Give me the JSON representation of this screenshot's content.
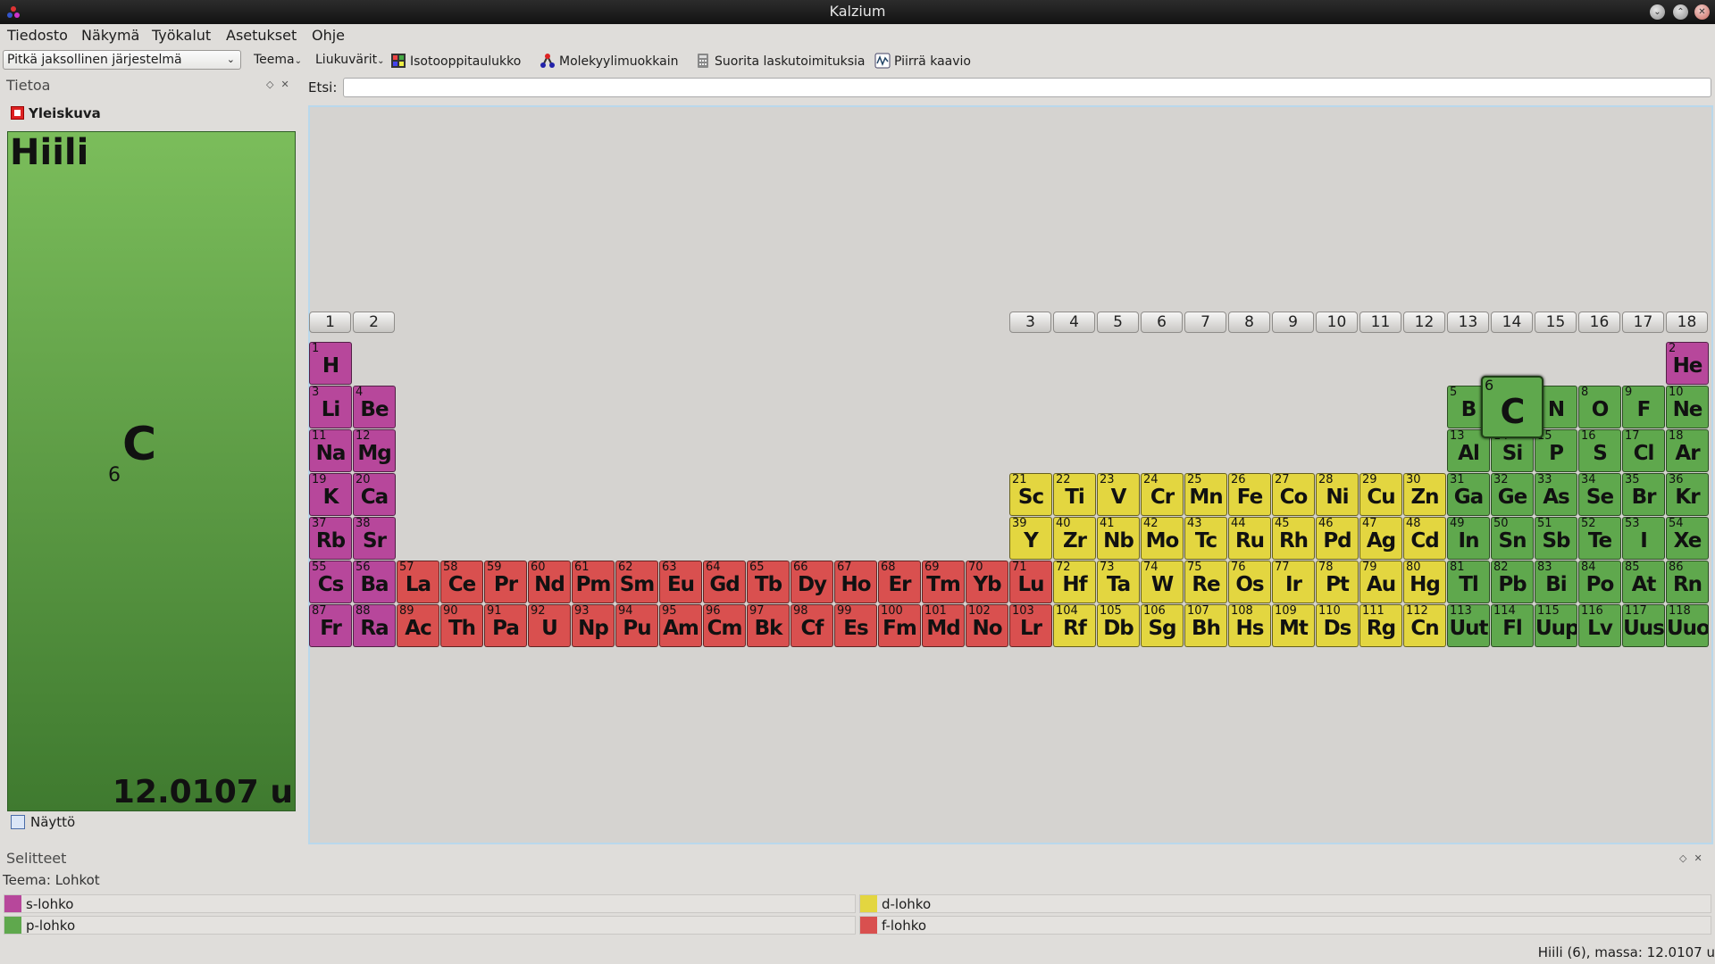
{
  "window": {
    "title": "Kalzium"
  },
  "menu": [
    "Tiedosto",
    "Näkymä",
    "Työkalut",
    "Asetukset",
    "Ohje"
  ],
  "toolbar": {
    "view_select": "Pitkä jaksollinen järjestelmä",
    "theme": "Teema",
    "sliders": "Liukuvärit",
    "isotope_table": "Isotooppitaulukko",
    "molecule_editor": "Molekyylimuokkain",
    "calculate": "Suorita laskutoimituksia",
    "plot": "Piirrä kaavio"
  },
  "info_dock": {
    "title": "Tietoa",
    "overview": "Yleiskuva",
    "element_name": "Hiili",
    "element_symbol": "C",
    "element_number": "6",
    "element_mass": "12.0107 u",
    "display_tab": "Näyttö"
  },
  "search": {
    "label": "Etsi:",
    "value": ""
  },
  "groups": [
    "1",
    "2",
    "3",
    "4",
    "5",
    "6",
    "7",
    "8",
    "9",
    "10",
    "11",
    "12",
    "13",
    "14",
    "15",
    "16",
    "17",
    "18"
  ],
  "block_colors": {
    "s": "#b7479b",
    "p": "#5fa84d",
    "d": "#e3d640",
    "f": "#d9504f"
  },
  "selected_element": "C",
  "elements": [
    {
      "n": 1,
      "s": "H",
      "r": 1,
      "c": 1,
      "b": "s"
    },
    {
      "n": 2,
      "s": "He",
      "r": 1,
      "c": 18,
      "b": "s"
    },
    {
      "n": 3,
      "s": "Li",
      "r": 2,
      "c": 1,
      "b": "s"
    },
    {
      "n": 4,
      "s": "Be",
      "r": 2,
      "c": 2,
      "b": "s"
    },
    {
      "n": 5,
      "s": "B",
      "r": 2,
      "c": 13,
      "b": "p"
    },
    {
      "n": 6,
      "s": "C",
      "r": 2,
      "c": 14,
      "b": "p"
    },
    {
      "n": 7,
      "s": "N",
      "r": 2,
      "c": 15,
      "b": "p"
    },
    {
      "n": 8,
      "s": "O",
      "r": 2,
      "c": 16,
      "b": "p"
    },
    {
      "n": 9,
      "s": "F",
      "r": 2,
      "c": 17,
      "b": "p"
    },
    {
      "n": 10,
      "s": "Ne",
      "r": 2,
      "c": 18,
      "b": "p"
    },
    {
      "n": 11,
      "s": "Na",
      "r": 3,
      "c": 1,
      "b": "s"
    },
    {
      "n": 12,
      "s": "Mg",
      "r": 3,
      "c": 2,
      "b": "s"
    },
    {
      "n": 13,
      "s": "Al",
      "r": 3,
      "c": 13,
      "b": "p"
    },
    {
      "n": 14,
      "s": "Si",
      "r": 3,
      "c": 14,
      "b": "p"
    },
    {
      "n": 15,
      "s": "P",
      "r": 3,
      "c": 15,
      "b": "p"
    },
    {
      "n": 16,
      "s": "S",
      "r": 3,
      "c": 16,
      "b": "p"
    },
    {
      "n": 17,
      "s": "Cl",
      "r": 3,
      "c": 17,
      "b": "p"
    },
    {
      "n": 18,
      "s": "Ar",
      "r": 3,
      "c": 18,
      "b": "p"
    },
    {
      "n": 19,
      "s": "K",
      "r": 4,
      "c": 1,
      "b": "s"
    },
    {
      "n": 20,
      "s": "Ca",
      "r": 4,
      "c": 2,
      "b": "s"
    },
    {
      "n": 21,
      "s": "Sc",
      "r": 4,
      "c": 3,
      "b": "d"
    },
    {
      "n": 22,
      "s": "Ti",
      "r": 4,
      "c": 4,
      "b": "d"
    },
    {
      "n": 23,
      "s": "V",
      "r": 4,
      "c": 5,
      "b": "d"
    },
    {
      "n": 24,
      "s": "Cr",
      "r": 4,
      "c": 6,
      "b": "d"
    },
    {
      "n": 25,
      "s": "Mn",
      "r": 4,
      "c": 7,
      "b": "d"
    },
    {
      "n": 26,
      "s": "Fe",
      "r": 4,
      "c": 8,
      "b": "d"
    },
    {
      "n": 27,
      "s": "Co",
      "r": 4,
      "c": 9,
      "b": "d"
    },
    {
      "n": 28,
      "s": "Ni",
      "r": 4,
      "c": 10,
      "b": "d"
    },
    {
      "n": 29,
      "s": "Cu",
      "r": 4,
      "c": 11,
      "b": "d"
    },
    {
      "n": 30,
      "s": "Zn",
      "r": 4,
      "c": 12,
      "b": "d"
    },
    {
      "n": 31,
      "s": "Ga",
      "r": 4,
      "c": 13,
      "b": "p"
    },
    {
      "n": 32,
      "s": "Ge",
      "r": 4,
      "c": 14,
      "b": "p"
    },
    {
      "n": 33,
      "s": "As",
      "r": 4,
      "c": 15,
      "b": "p"
    },
    {
      "n": 34,
      "s": "Se",
      "r": 4,
      "c": 16,
      "b": "p"
    },
    {
      "n": 35,
      "s": "Br",
      "r": 4,
      "c": 17,
      "b": "p"
    },
    {
      "n": 36,
      "s": "Kr",
      "r": 4,
      "c": 18,
      "b": "p"
    },
    {
      "n": 37,
      "s": "Rb",
      "r": 5,
      "c": 1,
      "b": "s"
    },
    {
      "n": 38,
      "s": "Sr",
      "r": 5,
      "c": 2,
      "b": "s"
    },
    {
      "n": 39,
      "s": "Y",
      "r": 5,
      "c": 3,
      "b": "d"
    },
    {
      "n": 40,
      "s": "Zr",
      "r": 5,
      "c": 4,
      "b": "d"
    },
    {
      "n": 41,
      "s": "Nb",
      "r": 5,
      "c": 5,
      "b": "d"
    },
    {
      "n": 42,
      "s": "Mo",
      "r": 5,
      "c": 6,
      "b": "d"
    },
    {
      "n": 43,
      "s": "Tc",
      "r": 5,
      "c": 7,
      "b": "d"
    },
    {
      "n": 44,
      "s": "Ru",
      "r": 5,
      "c": 8,
      "b": "d"
    },
    {
      "n": 45,
      "s": "Rh",
      "r": 5,
      "c": 9,
      "b": "d"
    },
    {
      "n": 46,
      "s": "Pd",
      "r": 5,
      "c": 10,
      "b": "d"
    },
    {
      "n": 47,
      "s": "Ag",
      "r": 5,
      "c": 11,
      "b": "d"
    },
    {
      "n": 48,
      "s": "Cd",
      "r": 5,
      "c": 12,
      "b": "d"
    },
    {
      "n": 49,
      "s": "In",
      "r": 5,
      "c": 13,
      "b": "p"
    },
    {
      "n": 50,
      "s": "Sn",
      "r": 5,
      "c": 14,
      "b": "p"
    },
    {
      "n": 51,
      "s": "Sb",
      "r": 5,
      "c": 15,
      "b": "p"
    },
    {
      "n": 52,
      "s": "Te",
      "r": 5,
      "c": 16,
      "b": "p"
    },
    {
      "n": 53,
      "s": "I",
      "r": 5,
      "c": 17,
      "b": "p"
    },
    {
      "n": 54,
      "s": "Xe",
      "r": 5,
      "c": 18,
      "b": "p"
    },
    {
      "n": 55,
      "s": "Cs",
      "r": 6,
      "c": 1,
      "b": "s"
    },
    {
      "n": 56,
      "s": "Ba",
      "r": 6,
      "c": 2,
      "b": "s"
    },
    {
      "n": 57,
      "s": "La",
      "r": 6,
      "c": 3,
      "b": "f"
    },
    {
      "n": 58,
      "s": "Ce",
      "r": 6,
      "c": 4,
      "b": "f"
    },
    {
      "n": 59,
      "s": "Pr",
      "r": 6,
      "c": 5,
      "b": "f"
    },
    {
      "n": 60,
      "s": "Nd",
      "r": 6,
      "c": 6,
      "b": "f"
    },
    {
      "n": 61,
      "s": "Pm",
      "r": 6,
      "c": 7,
      "b": "f"
    },
    {
      "n": 62,
      "s": "Sm",
      "r": 6,
      "c": 8,
      "b": "f"
    },
    {
      "n": 63,
      "s": "Eu",
      "r": 6,
      "c": 9,
      "b": "f"
    },
    {
      "n": 64,
      "s": "Gd",
      "r": 6,
      "c": 10,
      "b": "f"
    },
    {
      "n": 65,
      "s": "Tb",
      "r": 6,
      "c": 11,
      "b": "f"
    },
    {
      "n": 66,
      "s": "Dy",
      "r": 6,
      "c": 12,
      "b": "f"
    },
    {
      "n": 67,
      "s": "Ho",
      "r": 6,
      "c": 13,
      "b": "f"
    },
    {
      "n": 68,
      "s": "Er",
      "r": 6,
      "c": 14,
      "b": "f"
    },
    {
      "n": 69,
      "s": "Tm",
      "r": 6,
      "c": 15,
      "b": "f"
    },
    {
      "n": 70,
      "s": "Yb",
      "r": 6,
      "c": 16,
      "b": "f"
    },
    {
      "n": 71,
      "s": "Lu",
      "r": 6,
      "c": 17,
      "b": "f"
    },
    {
      "n": 72,
      "s": "Hf",
      "r": 6,
      "c": 18,
      "b": "d"
    },
    {
      "n": 73,
      "s": "Ta",
      "r": 6,
      "c": 19,
      "b": "d"
    },
    {
      "n": 74,
      "s": "W",
      "r": 6,
      "c": 20,
      "b": "d"
    },
    {
      "n": 75,
      "s": "Re",
      "r": 6,
      "c": 21,
      "b": "d"
    },
    {
      "n": 76,
      "s": "Os",
      "r": 6,
      "c": 22,
      "b": "d"
    },
    {
      "n": 77,
      "s": "Ir",
      "r": 6,
      "c": 23,
      "b": "d"
    },
    {
      "n": 78,
      "s": "Pt",
      "r": 6,
      "c": 24,
      "b": "d"
    },
    {
      "n": 79,
      "s": "Au",
      "r": 6,
      "c": 25,
      "b": "d"
    },
    {
      "n": 80,
      "s": "Hg",
      "r": 6,
      "c": 26,
      "b": "d"
    },
    {
      "n": 81,
      "s": "Tl",
      "r": 6,
      "c": 27,
      "b": "p"
    },
    {
      "n": 82,
      "s": "Pb",
      "r": 6,
      "c": 28,
      "b": "p"
    },
    {
      "n": 83,
      "s": "Bi",
      "r": 6,
      "c": 29,
      "b": "p"
    },
    {
      "n": 84,
      "s": "Po",
      "r": 6,
      "c": 30,
      "b": "p"
    },
    {
      "n": 85,
      "s": "At",
      "r": 6,
      "c": 31,
      "b": "p"
    },
    {
      "n": 86,
      "s": "Rn",
      "r": 6,
      "c": 32,
      "b": "p"
    },
    {
      "n": 87,
      "s": "Fr",
      "r": 7,
      "c": 1,
      "b": "s"
    },
    {
      "n": 88,
      "s": "Ra",
      "r": 7,
      "c": 2,
      "b": "s"
    },
    {
      "n": 89,
      "s": "Ac",
      "r": 7,
      "c": 3,
      "b": "f"
    },
    {
      "n": 90,
      "s": "Th",
      "r": 7,
      "c": 4,
      "b": "f"
    },
    {
      "n": 91,
      "s": "Pa",
      "r": 7,
      "c": 5,
      "b": "f"
    },
    {
      "n": 92,
      "s": "U",
      "r": 7,
      "c": 6,
      "b": "f"
    },
    {
      "n": 93,
      "s": "Np",
      "r": 7,
      "c": 7,
      "b": "f"
    },
    {
      "n": 94,
      "s": "Pu",
      "r": 7,
      "c": 8,
      "b": "f"
    },
    {
      "n": 95,
      "s": "Am",
      "r": 7,
      "c": 9,
      "b": "f"
    },
    {
      "n": 96,
      "s": "Cm",
      "r": 7,
      "c": 10,
      "b": "f"
    },
    {
      "n": 97,
      "s": "Bk",
      "r": 7,
      "c": 11,
      "b": "f"
    },
    {
      "n": 98,
      "s": "Cf",
      "r": 7,
      "c": 12,
      "b": "f"
    },
    {
      "n": 99,
      "s": "Es",
      "r": 7,
      "c": 13,
      "b": "f"
    },
    {
      "n": 100,
      "s": "Fm",
      "r": 7,
      "c": 14,
      "b": "f"
    },
    {
      "n": 101,
      "s": "Md",
      "r": 7,
      "c": 15,
      "b": "f"
    },
    {
      "n": 102,
      "s": "No",
      "r": 7,
      "c": 16,
      "b": "f"
    },
    {
      "n": 103,
      "s": "Lr",
      "r": 7,
      "c": 17,
      "b": "f"
    },
    {
      "n": 104,
      "s": "Rf",
      "r": 7,
      "c": 18,
      "b": "d"
    },
    {
      "n": 105,
      "s": "Db",
      "r": 7,
      "c": 19,
      "b": "d"
    },
    {
      "n": 106,
      "s": "Sg",
      "r": 7,
      "c": 20,
      "b": "d"
    },
    {
      "n": 107,
      "s": "Bh",
      "r": 7,
      "c": 21,
      "b": "d"
    },
    {
      "n": 108,
      "s": "Hs",
      "r": 7,
      "c": 22,
      "b": "d"
    },
    {
      "n": 109,
      "s": "Mt",
      "r": 7,
      "c": 23,
      "b": "d"
    },
    {
      "n": 110,
      "s": "Ds",
      "r": 7,
      "c": 24,
      "b": "d"
    },
    {
      "n": 111,
      "s": "Rg",
      "r": 7,
      "c": 25,
      "b": "d"
    },
    {
      "n": 112,
      "s": "Cn",
      "r": 7,
      "c": 26,
      "b": "d"
    },
    {
      "n": 113,
      "s": "Uut",
      "r": 7,
      "c": 27,
      "b": "p"
    },
    {
      "n": 114,
      "s": "Fl",
      "r": 7,
      "c": 28,
      "b": "p"
    },
    {
      "n": 115,
      "s": "Uup",
      "r": 7,
      "c": 29,
      "b": "p"
    },
    {
      "n": 116,
      "s": "Lv",
      "r": 7,
      "c": 30,
      "b": "p"
    },
    {
      "n": 117,
      "s": "Uus",
      "r": 7,
      "c": 31,
      "b": "p"
    },
    {
      "n": 118,
      "s": "Uuo",
      "r": 7,
      "c": 32,
      "b": "p"
    }
  ],
  "legend": {
    "title": "Selitteet",
    "theme": "Teema: Lohkot",
    "items": [
      {
        "label": "s-lohko",
        "color": "#b7479b"
      },
      {
        "label": "d-lohko",
        "color": "#e3d640"
      },
      {
        "label": "p-lohko",
        "color": "#5fa84d"
      },
      {
        "label": "f-lohko",
        "color": "#d9504f"
      }
    ]
  },
  "status": "Hiili (6), massa: 12.0107 u"
}
